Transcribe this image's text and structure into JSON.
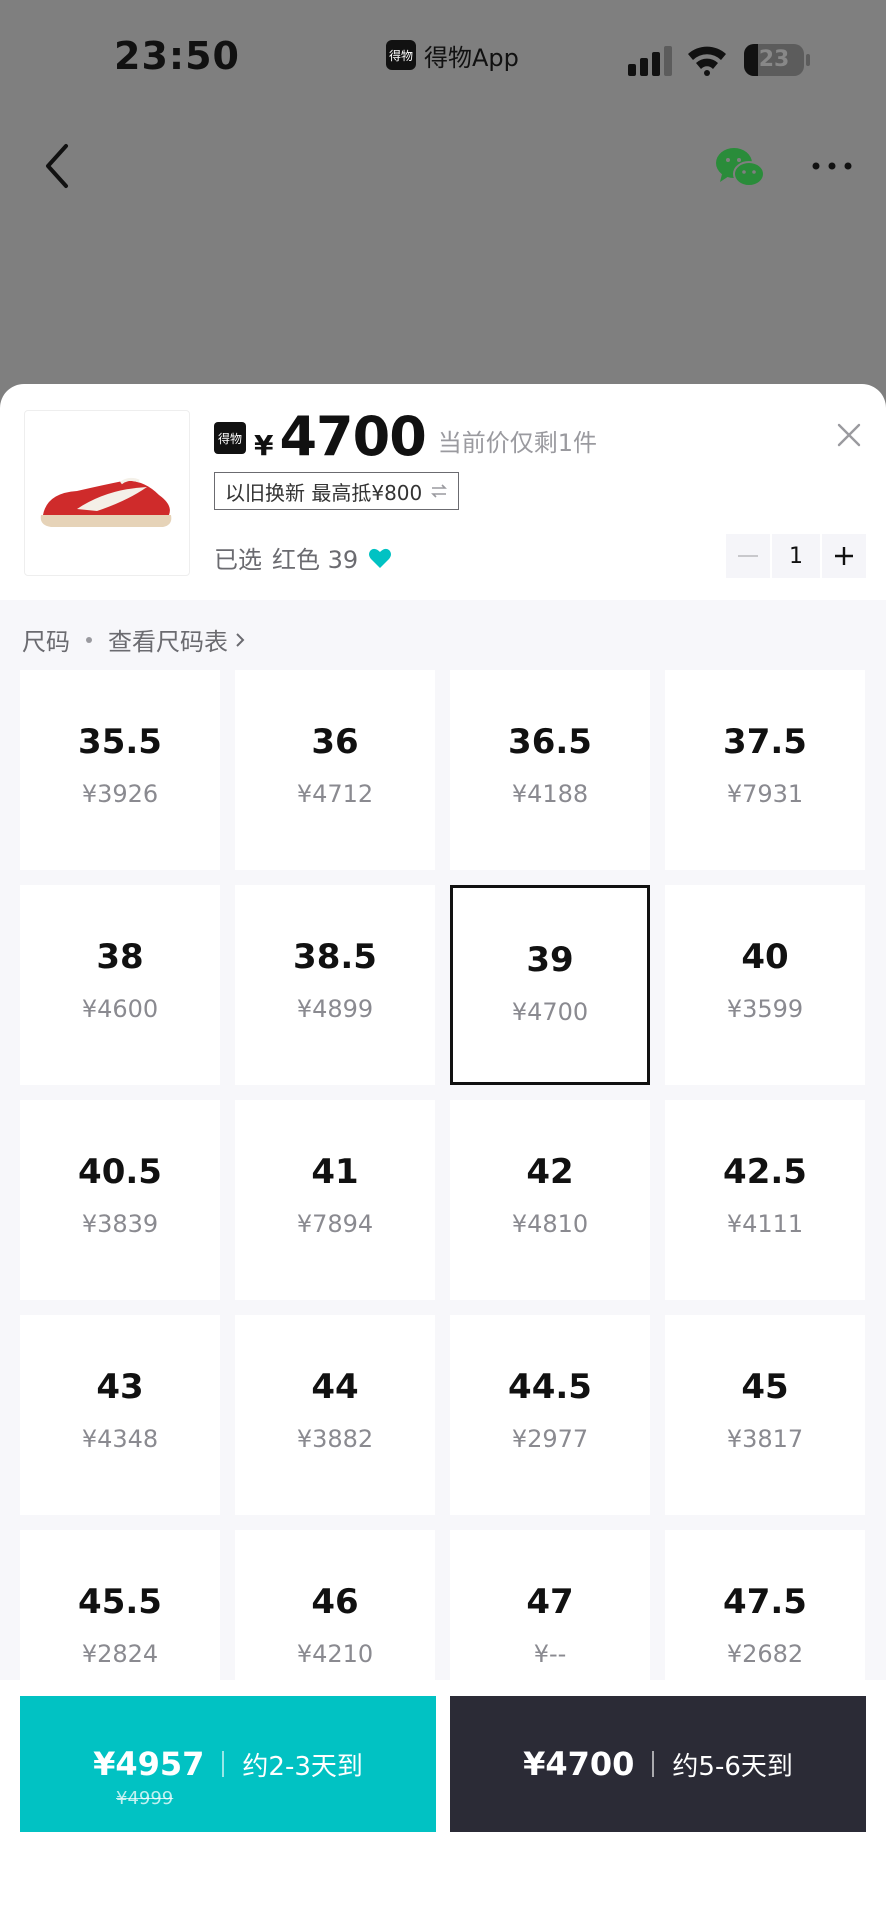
{
  "status_bar": {
    "time": "23:50",
    "app_name": "得物App",
    "app_logo_text": "得物",
    "battery": "23"
  },
  "product": {
    "badge": "得物",
    "currency": "¥",
    "price": "4700",
    "stock_note": "当前价仅剩1件",
    "trade_in": "以旧换新 最高抵¥800",
    "selected_label": "已选",
    "selected_value": "红色 39",
    "quantity": "1"
  },
  "size_section": {
    "title": "尺码",
    "chart_link": "查看尺码表"
  },
  "sizes": [
    {
      "size": "35.5",
      "price": "¥3926"
    },
    {
      "size": "36",
      "price": "¥4712"
    },
    {
      "size": "36.5",
      "price": "¥4188"
    },
    {
      "size": "37.5",
      "price": "¥7931"
    },
    {
      "size": "38",
      "price": "¥4600"
    },
    {
      "size": "38.5",
      "price": "¥4899"
    },
    {
      "size": "39",
      "price": "¥4700",
      "selected": true
    },
    {
      "size": "40",
      "price": "¥3599"
    },
    {
      "size": "40.5",
      "price": "¥3839"
    },
    {
      "size": "41",
      "price": "¥7894"
    },
    {
      "size": "42",
      "price": "¥4810"
    },
    {
      "size": "42.5",
      "price": "¥4111"
    },
    {
      "size": "43",
      "price": "¥4348"
    },
    {
      "size": "44",
      "price": "¥3882"
    },
    {
      "size": "44.5",
      "price": "¥2977"
    },
    {
      "size": "45",
      "price": "¥3817"
    },
    {
      "size": "45.5",
      "price": "¥2824"
    },
    {
      "size": "46",
      "price": "¥4210"
    },
    {
      "size": "47",
      "price": "¥--"
    },
    {
      "size": "47.5",
      "price": "¥2682"
    }
  ],
  "buttons": {
    "fast": {
      "price": "¥4957",
      "original_price": "¥4999",
      "delivery": "约2-3天到",
      "color": "#01c2c3"
    },
    "normal": {
      "price": "¥4700",
      "delivery": "约5-6天到",
      "color": "#2b2b36"
    }
  },
  "icons": {
    "back": "chevron-left-icon",
    "share": "wechat-icon",
    "more": "more-icon",
    "close": "close-icon",
    "swap": "swap-icon",
    "favorite": "heart-icon",
    "minus": "minus-icon",
    "plus": "plus-icon",
    "chevron": "chevron-right-icon"
  },
  "colors": {
    "accent": "#01c2c3",
    "dark": "#2b2b36",
    "heart": "#01c2c3",
    "wechat": "#2a8c3a"
  }
}
